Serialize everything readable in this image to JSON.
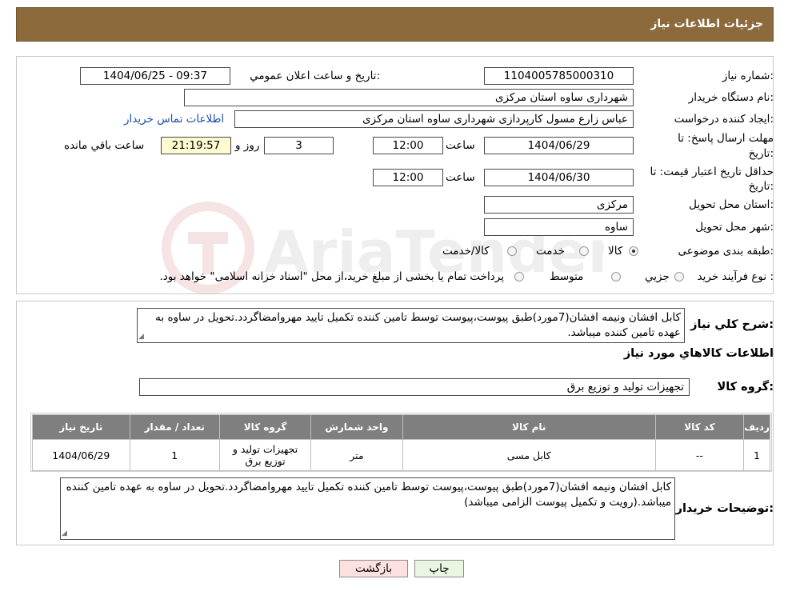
{
  "header": {
    "title": "جزئیات اطلاعات نیاز"
  },
  "form": {
    "need_number_label": "شماره نیاز:",
    "need_number": "1104005785000310",
    "announce_label": "تاریخ و ساعت اعلان عمومي:",
    "announce_value": "1404/06/25 - 09:37",
    "buyer_org_label": "نام دستگاه خريدار:",
    "buyer_org": "شهرداری ساوه استان مرکزی",
    "creator_label": "ايجاد کننده درخواست:",
    "creator": "عباس زارع مسول کارپردازی شهرداری ساوه استان مرکزی",
    "contact_link": "اطلاعات تماس خريدار",
    "deadline_label_1": "مهلت ارسال پاسخ: تا",
    "deadline_label_2": "تاريخ:",
    "deadline_date": "1404/06/29",
    "time_label": "ساعت",
    "deadline_time": "12:00",
    "days_value": "3",
    "days_label": "روز و",
    "remaining_time": "21:19:57",
    "remaining_label": "ساعت باقي مانده",
    "validity_label_1": "حداقل تاريخ اعتبار قيمت: تا",
    "validity_label_2": "تاريخ:",
    "validity_date": "1404/06/30",
    "validity_time": "12:00",
    "province_label": "استان محل تحويل:",
    "province": "مرکزی",
    "city_label": "شهر محل تحويل:",
    "city": "ساوه",
    "category_label": "طبقه بندی موضوعی:",
    "category_options": [
      "کالا",
      "خدمت",
      "کالا/خدمت"
    ],
    "category_selected": 0,
    "process_label": "نوع فرآيند خريد :",
    "process_options": [
      "جزيي",
      "متوسط"
    ],
    "process_note": "پرداخت تمام يا بخشی از مبلغ خريد،از محل \"اسناد خزانه اسلامی\" خواهد بود."
  },
  "details": {
    "general_desc_label": "شرح کلي نياز:",
    "general_desc": "كابل افشان ونيمه افشان(7مورد)طبق پيوست،پيوست توسط تامين كننده تكميل تاييد مهروامضاگردد.تحويل در ساوه به عهده تامين كننده ميباشد.",
    "goods_info_title": "اطلاعات کالاهاي مورد نياز",
    "goods_group_label": "گروه کالا:",
    "goods_group": "تجهیزات تولید و توزیع برق",
    "table": {
      "headers": [
        "رديف",
        "کد کالا",
        "نام کالا",
        "واحد شمارش",
        "گروه کالا",
        "تعداد / مقدار",
        "تاريخ نياز"
      ],
      "rows": [
        [
          "1",
          "--",
          "کابل مسی",
          "متر",
          "تجهیزات تولید و توزیع برق",
          "1",
          "1404/06/29"
        ]
      ]
    },
    "buyer_notes_label": "توضيحات خريدار:",
    "buyer_notes": "كابل افشان ونيمه افشان(7مورد)طبق پيوست،پيوست توسط تامين كننده تكميل تاييد مهروامضاگردد.تحويل در ساوه به عهده تامين كننده ميباشد.(رويت و تكميل پيوست الزامی ميباشد)"
  },
  "buttons": {
    "print": "چاپ",
    "back": "بازگشت"
  },
  "watermark": {
    "text": "AriaTender.neT"
  },
  "colors": {
    "header_bg": "#8c6a3c",
    "table_header_bg": "#7f7f7f",
    "back_button_bg": "#fde0e0",
    "print_button_bg": "#eaf6e2",
    "remaining_bg": "#fffcd2"
  }
}
